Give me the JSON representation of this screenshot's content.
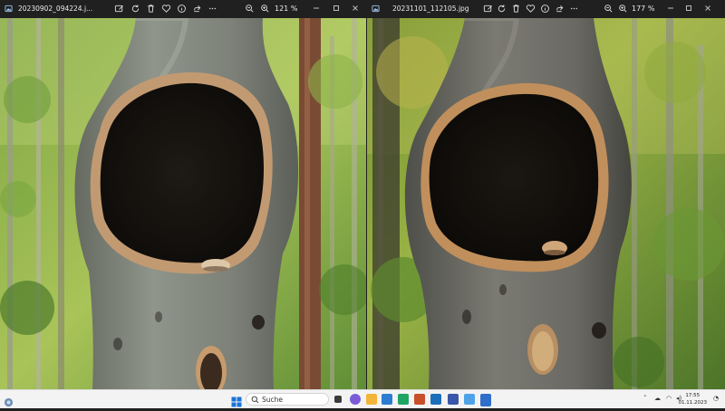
{
  "left_window": {
    "title": "20230902_094224.j...",
    "zoom": "121 %"
  },
  "right_window": {
    "title": "20231101_112105.jpg",
    "zoom": "177 %"
  },
  "taskbar": {
    "search_label": "Suche",
    "time": "17:55",
    "date": "01.11.2023"
  }
}
